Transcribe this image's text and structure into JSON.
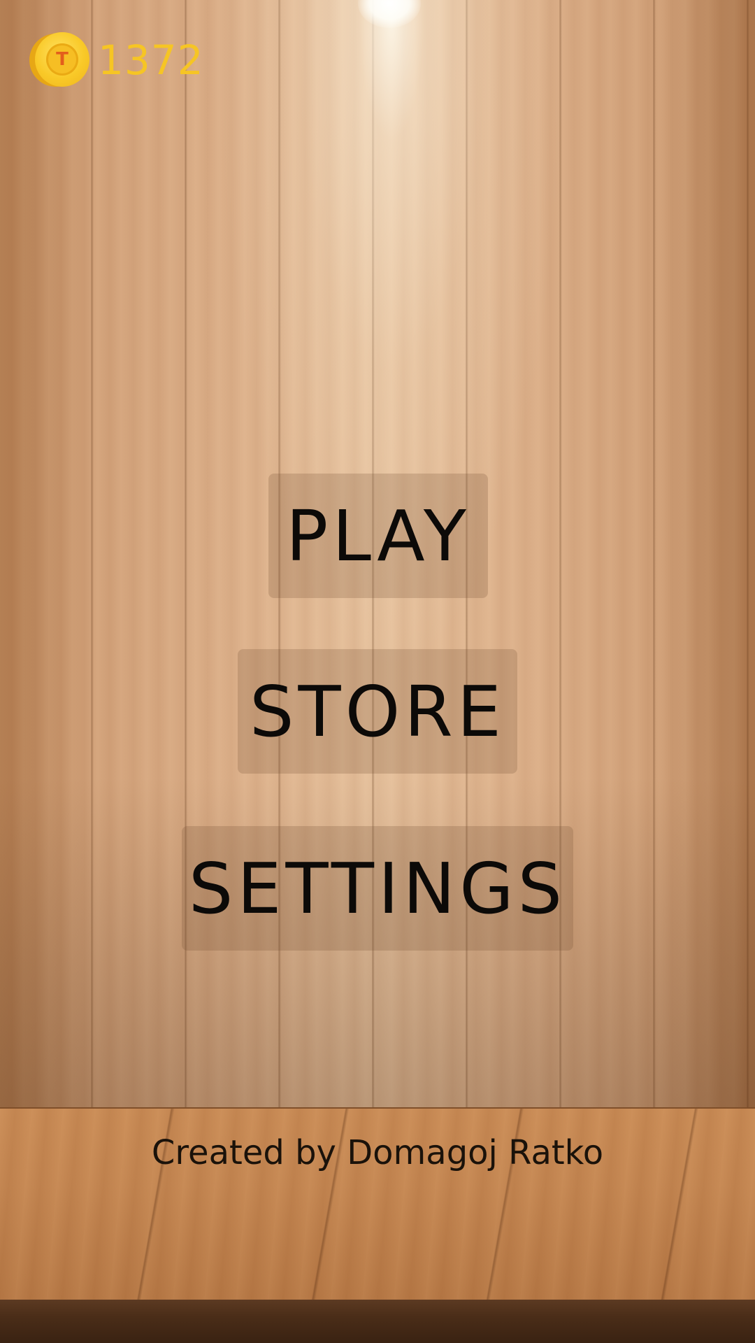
{
  "hud": {
    "coin_icon": "coin-icon",
    "coin_symbol": "T",
    "coin_count": "1372",
    "coin_color": "#f6c524"
  },
  "menu": {
    "play_label": "PLAY",
    "store_label": "STORE",
    "settings_label": "SETTINGS"
  },
  "footer": {
    "credit": "Created by Domagoj Ratko"
  },
  "theme": {
    "background": "wooden-wall-with-spotlight",
    "text_color": "#0c0a08"
  }
}
